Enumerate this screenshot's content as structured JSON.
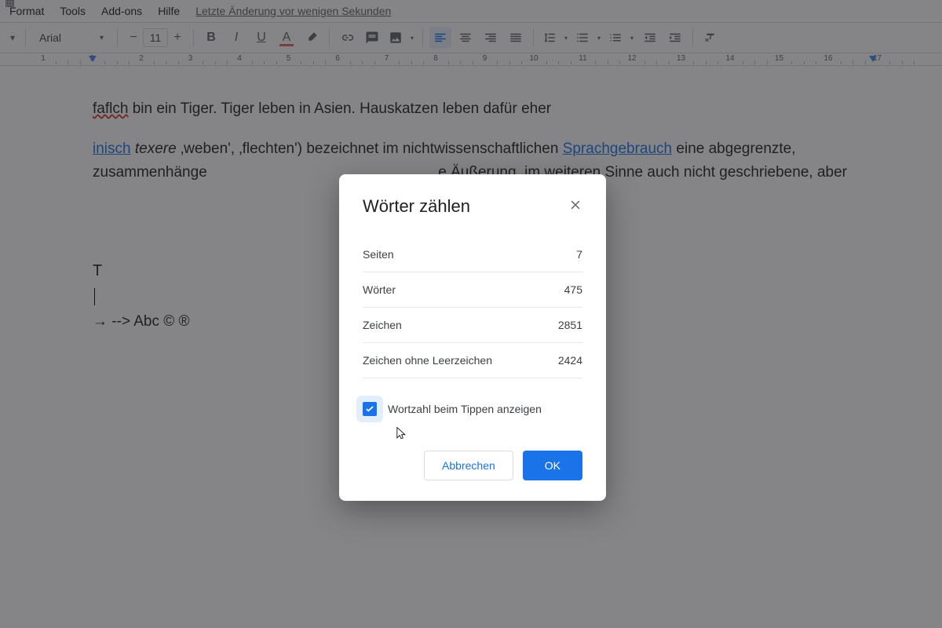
{
  "menubar": {
    "items": [
      "Format",
      "Tools",
      "Add-ons",
      "Hilfe"
    ],
    "recent_change": "Letzte Änderung vor wenigen Sekunden"
  },
  "toolbar": {
    "font_name": "Arial",
    "font_size": "11"
  },
  "ruler": {
    "numbers": [
      "1",
      "1",
      "2",
      "3",
      "4",
      "5",
      "6",
      "7",
      "8",
      "9",
      "10",
      "11",
      "12",
      "13",
      "14",
      "15",
      "16",
      "17"
    ]
  },
  "document": {
    "line1_err": "faflch",
    "line1_rest": " bin ein Tiger. Tiger leben in Asien. Hauskatzen leben dafür eher",
    "p2_link1": "inisch",
    "p2_italic": "texere",
    "p2_mid1": " ‚weben', ‚flechten') bezeichnet im nichtwissenschaftlichen ",
    "p2_link2": "Sprachgebrauch",
    "p2_mid2": " eine abgegrenzte, zusammenhänge",
    "p2_mid3": "e Äußerung, im weiteren Sinne auch nicht geschriebene, aber",
    "solo_t": "T",
    "symbols": "→ --> Abc © ®"
  },
  "dialog": {
    "title": "Wörter zählen",
    "stats": [
      {
        "label": "Seiten",
        "value": "7"
      },
      {
        "label": "Wörter",
        "value": "475"
      },
      {
        "label": "Zeichen",
        "value": "2851"
      },
      {
        "label": "Zeichen ohne Leerzeichen",
        "value": "2424"
      }
    ],
    "checkbox_label": "Wortzahl beim Tippen anzeigen",
    "cancel": "Abbrechen",
    "ok": "OK"
  }
}
